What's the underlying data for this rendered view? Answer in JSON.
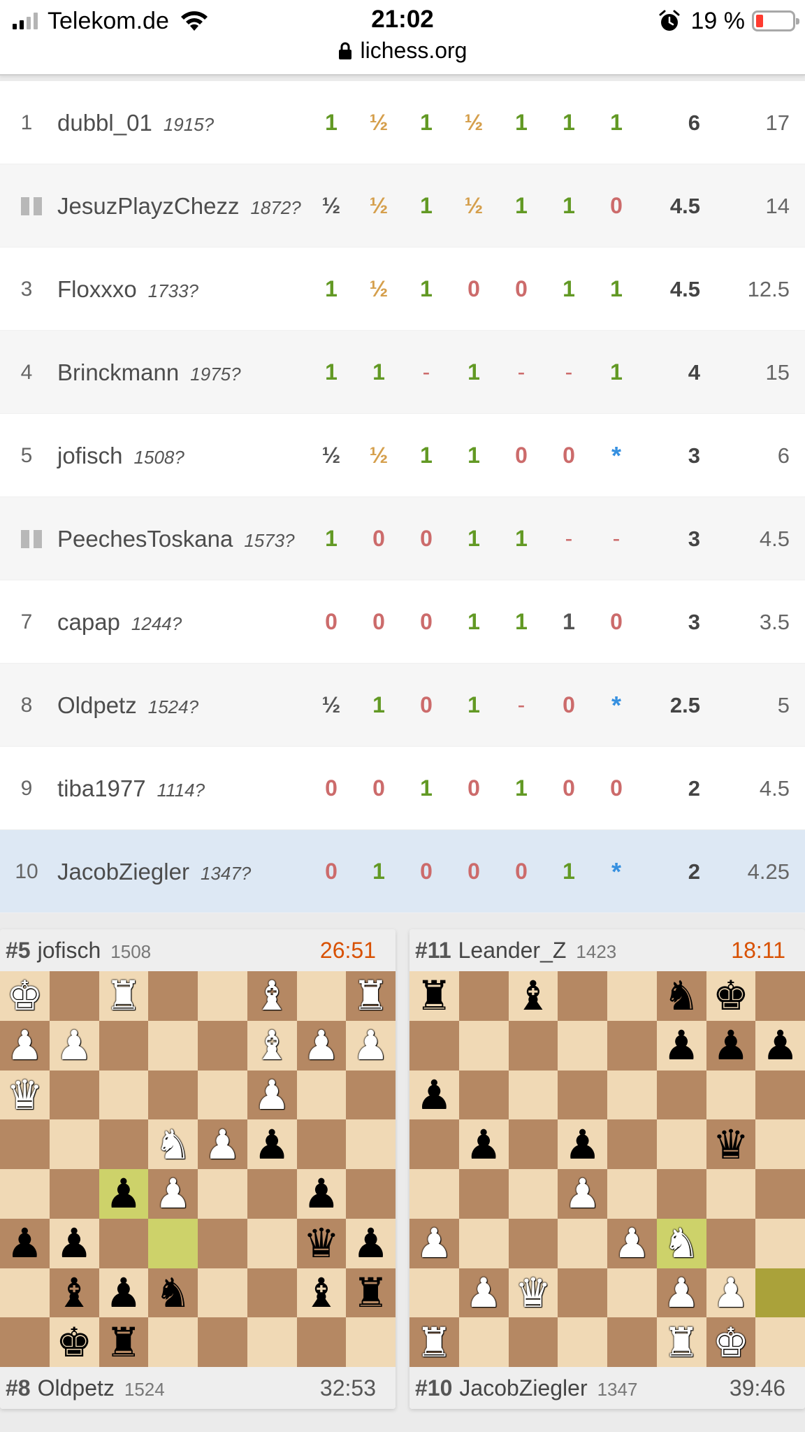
{
  "status_bar": {
    "carrier": "Telekom.de",
    "time": "21:02",
    "battery": "19 %",
    "url": "lichess.org"
  },
  "standings": [
    {
      "rank": "1",
      "paused": false,
      "name": "dubbl_01",
      "rating": "1915?",
      "results": [
        "1",
        "½",
        "1",
        "½",
        "1",
        "1",
        "1"
      ],
      "score": "6",
      "tiebreak": "17"
    },
    {
      "rank": "",
      "paused": true,
      "name": "JesuzPlayzChezz",
      "rating": "1872?",
      "results": [
        "½",
        "½",
        "1",
        "½",
        "1",
        "1",
        "0"
      ],
      "score": "4.5",
      "tiebreak": "14"
    },
    {
      "rank": "3",
      "paused": false,
      "name": "Floxxxo",
      "rating": "1733?",
      "results": [
        "1",
        "½",
        "1",
        "0",
        "0",
        "1",
        "1"
      ],
      "score": "4.5",
      "tiebreak": "12.5"
    },
    {
      "rank": "4",
      "paused": false,
      "name": "Brinckmann",
      "rating": "1975?",
      "results": [
        "1",
        "1",
        "-",
        "1",
        "-",
        "-",
        "1"
      ],
      "score": "4",
      "tiebreak": "15"
    },
    {
      "rank": "5",
      "paused": false,
      "name": "jofisch",
      "rating": "1508?",
      "results": [
        "½",
        "½",
        "1",
        "1",
        "0",
        "0",
        "*"
      ],
      "score": "3",
      "tiebreak": "6"
    },
    {
      "rank": "",
      "paused": true,
      "name": "PeechesToskana",
      "rating": "1573?",
      "results": [
        "1",
        "0",
        "0",
        "1",
        "1",
        "-",
        "-"
      ],
      "score": "3",
      "tiebreak": "4.5"
    },
    {
      "rank": "7",
      "paused": false,
      "name": "capap",
      "rating": "1244?",
      "results": [
        "0",
        "0",
        "0",
        "1",
        "1",
        "1",
        "0"
      ],
      "score": "3",
      "tiebreak": "3.5"
    },
    {
      "rank": "8",
      "paused": false,
      "name": "Oldpetz",
      "rating": "1524?",
      "results": [
        "½",
        "1",
        "0",
        "1",
        "-",
        "0",
        "*"
      ],
      "score": "2.5",
      "tiebreak": "5"
    },
    {
      "rank": "9",
      "paused": false,
      "name": "tiba1977",
      "rating": "1114?",
      "results": [
        "0",
        "0",
        "1",
        "0",
        "1",
        "0",
        "0"
      ],
      "score": "2",
      "tiebreak": "4.5"
    },
    {
      "rank": "10",
      "paused": false,
      "name": "JacobZiegler",
      "rating": "1347?",
      "results": [
        "0",
        "1",
        "0",
        "0",
        "0",
        "1",
        "*"
      ],
      "score": "2",
      "tiebreak": "4.25",
      "highlight": true
    }
  ],
  "result_styles": {
    "rows": [
      [
        "win",
        "draw",
        "win",
        "draw",
        "win",
        "win",
        "win"
      ],
      [
        "half",
        "draw",
        "win",
        "draw",
        "win",
        "win",
        "loss"
      ],
      [
        "win",
        "draw",
        "win",
        "loss",
        "loss",
        "win",
        "win"
      ],
      [
        "win",
        "win",
        "dash",
        "win",
        "dash",
        "dash",
        "win"
      ],
      [
        "half",
        "draw",
        "win",
        "win",
        "loss",
        "loss",
        "star"
      ],
      [
        "win",
        "loss",
        "loss",
        "win",
        "win",
        "dash",
        "dash"
      ],
      [
        "loss",
        "loss",
        "loss",
        "win",
        "win",
        "half",
        "loss"
      ],
      [
        "half",
        "win",
        "loss",
        "win",
        "dash",
        "loss",
        "star"
      ],
      [
        "loss",
        "loss",
        "win",
        "loss",
        "win",
        "loss",
        "loss"
      ],
      [
        "loss",
        "win",
        "loss",
        "loss",
        "loss",
        "win",
        "star"
      ]
    ]
  },
  "boards": [
    {
      "top": {
        "number": "#5",
        "name": "jofisch",
        "rating": "1508",
        "clock": "26:51",
        "running": true
      },
      "bottom": {
        "number": "#8",
        "name": "Oldpetz",
        "rating": "1524",
        "clock": "32:53",
        "running": false
      },
      "highlights": [
        "c4",
        "d3"
      ],
      "ranks": [
        [
          "wK",
          "",
          "wR",
          "",
          "",
          "wB",
          "",
          "wR"
        ],
        [
          "wP",
          "wP",
          "",
          "",
          "",
          "wB",
          "wP",
          "wP"
        ],
        [
          "wQ",
          "",
          "",
          "",
          "",
          "wP",
          "",
          ""
        ],
        [
          "",
          "",
          "",
          "wN",
          "wP",
          "bP",
          "",
          ""
        ],
        [
          "",
          "",
          "bP",
          "wP",
          "",
          "",
          "bP",
          ""
        ],
        [
          "bP",
          "bP",
          "",
          "",
          "",
          "",
          "bQ",
          "bP"
        ],
        [
          "",
          "bB",
          "bP",
          "bN",
          "",
          "",
          "bB",
          "bR"
        ],
        [
          "",
          "bK",
          "bR",
          "",
          "",
          "",
          "",
          ""
        ]
      ]
    },
    {
      "top": {
        "number": "#11",
        "name": "Leander_Z",
        "rating": "1423",
        "clock": "18:11",
        "running": true
      },
      "bottom": {
        "number": "#10",
        "name": "JacobZiegler",
        "rating": "1347",
        "clock": "39:46",
        "running": false
      },
      "highlights": [
        "f3",
        "h2"
      ],
      "ranks": [
        [
          "bR",
          "",
          "bB",
          "",
          "",
          "bN",
          "bK",
          ""
        ],
        [
          "",
          "",
          "",
          "",
          "",
          "bP",
          "bP",
          "bP"
        ],
        [
          "bP",
          "",
          "",
          "",
          "",
          "",
          "",
          ""
        ],
        [
          "",
          "bP",
          "",
          "bP",
          "",
          "",
          "bQ",
          ""
        ],
        [
          "",
          "",
          "",
          "wP",
          "",
          "",
          "",
          ""
        ],
        [
          "wP",
          "",
          "",
          "",
          "wP",
          "wN",
          "",
          ""
        ],
        [
          "",
          "wP",
          "wQ",
          "",
          "",
          "wP",
          "wP",
          ""
        ],
        [
          "wR",
          "",
          "",
          "",
          "",
          "wR",
          "wK",
          ""
        ]
      ]
    }
  ],
  "piece_glyphs": {
    "K": "♚",
    "Q": "♛",
    "R": "♜",
    "B": "♝",
    "N": "♞",
    "P": "♟"
  },
  "colors": {
    "win": "#629924",
    "draw": "#d59f4c",
    "loss": "#cc6b6b",
    "ongoing": "#3690e0",
    "board_light": "#f0d9b5",
    "board_dark": "#b58863",
    "highlight": "#cdd26a",
    "clock_running": "#d85000",
    "my_row": "#dde8f4"
  }
}
